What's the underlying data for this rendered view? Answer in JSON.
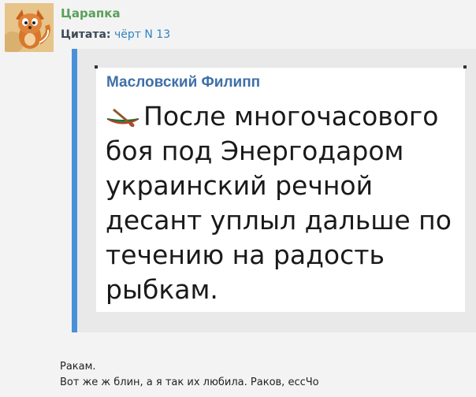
{
  "post": {
    "username": "Царапка",
    "quote_label": "Цитата:",
    "quote_author": "чёрт N 13",
    "avatar_icon": "fox-avatar"
  },
  "quoted_card": {
    "author": "Масловский Филипп",
    "icon": "canoe-icon",
    "text": "После многочасового боя под Энергодаром украинский речной десант уплыл дальше по течению на радость рыбкам."
  },
  "reply": {
    "line1": "Ракам.",
    "line2": "Вот же ж блин, а я так их любила. Раков, ессЧо"
  },
  "colors": {
    "username": "#5aa05a",
    "link": "#2f83c5",
    "quote_bar": "#4a90d9",
    "card_author": "#3f6fa8",
    "background": "#f3f3f3"
  }
}
